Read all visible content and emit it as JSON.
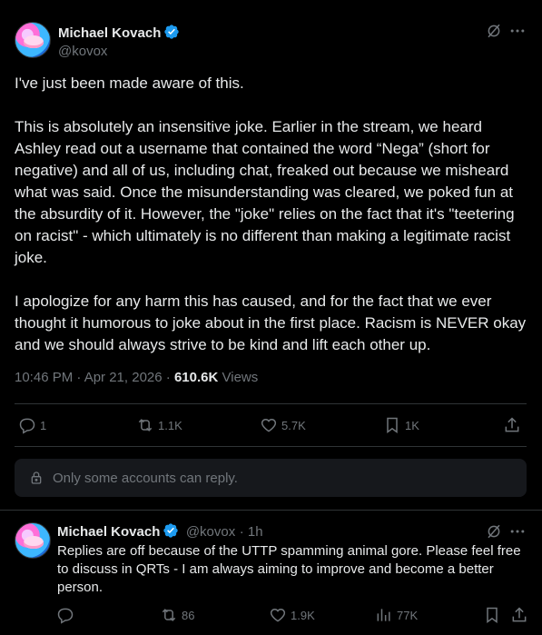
{
  "main_post": {
    "author_name": "Michael Kovach",
    "author_handle": "@kovox",
    "text": "I've just been made aware of this.\n\nThis is absolutely an insensitive joke. Earlier in the stream, we heard Ashley read out a username that contained the word “Nega” (short for negative) and all of us, including chat, freaked out because we misheard what was said. Once the misunderstanding was cleared, we poked fun at the absurdity of it. However, the \"joke\" relies on the fact that it's \"teetering on racist\" - which ultimately is no different than making a legitimate racist joke.\n\nI apologize for any harm this has caused, and for the fact that we ever thought it humorous to joke about in the first place. Racism is NEVER okay and we should always strive to be kind and lift each other up.",
    "timestamp": "10:46 PM · Apr 21, 2026",
    "separator": "·",
    "views_count": "610.6K",
    "views_label": "Views",
    "actions": {
      "replies": "1",
      "reposts": "1.1K",
      "likes": "5.7K",
      "bookmarks": "1K"
    }
  },
  "reply_restriction": "Only some accounts can reply.",
  "reply_post": {
    "author_name": "Michael Kovach",
    "author_handle": "@kovox",
    "time": "· 1h",
    "text": "Replies are off because of the UTTP spamming animal gore. Please feel free to discuss in QRTs - I am always aiming to improve and become a better person.",
    "actions": {
      "reposts": "86",
      "likes": "1.9K",
      "views": "77K"
    }
  },
  "icons": {
    "verified": "verified-badge-icon",
    "grok": "grok-icon",
    "more": "more-icon",
    "reply": "reply-icon",
    "repost": "repost-icon",
    "like": "heart-icon",
    "bookmark": "bookmark-icon",
    "share": "share-icon",
    "views": "views-icon",
    "lock": "lock-icon"
  },
  "colors": {
    "background": "#000000",
    "text": "#e7e9ea",
    "muted": "#71767b",
    "verified": "#1d9bf0",
    "divider": "#2f3336",
    "note_bg": "#16181c"
  }
}
